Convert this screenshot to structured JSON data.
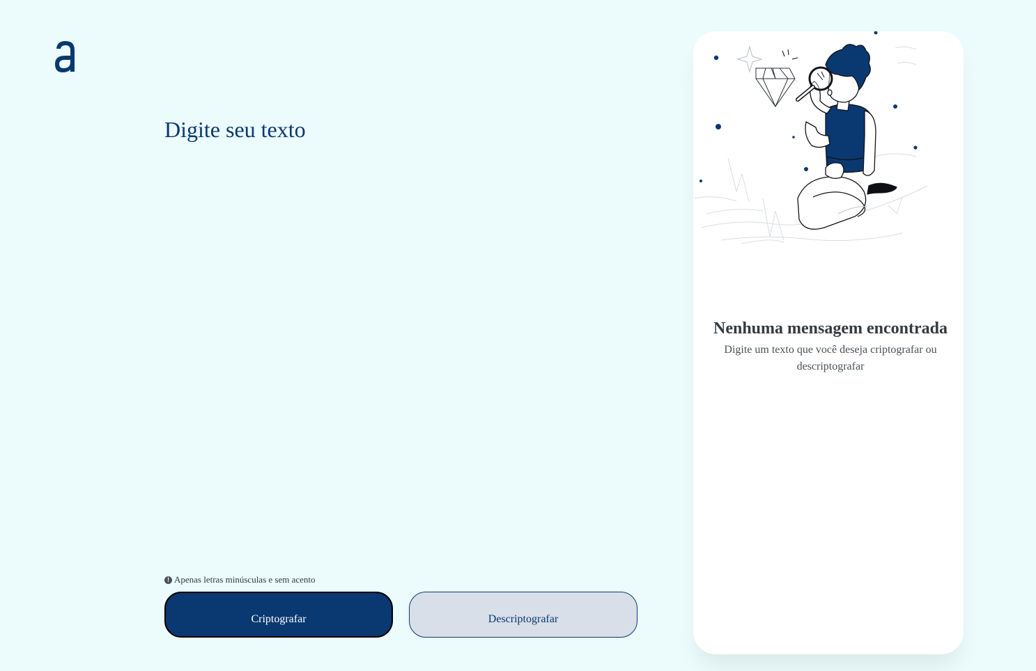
{
  "logo": {
    "icon": "alura-a-logo-icon",
    "color": "#0a3871"
  },
  "input": {
    "placeholder": "Digite seu texto",
    "value": ""
  },
  "hint": {
    "icon": "info-circle-icon",
    "text": "Apenas letras minúsculas e sem acento"
  },
  "buttons": {
    "encrypt_label": "Criptografar",
    "decrypt_label": "Descriptografar"
  },
  "output": {
    "illustration": "person-with-magnifying-glass-illustration",
    "empty_title": "Nenhuma mensagem encontrada",
    "empty_description": "Digite um texto que você deseja criptografar ou descriptografar"
  },
  "colors": {
    "background": "#ecfbfb",
    "primary": "#0a3871",
    "secondary_button": "#d8dfe8",
    "card": "#ffffff",
    "text_dark": "#343a40"
  }
}
